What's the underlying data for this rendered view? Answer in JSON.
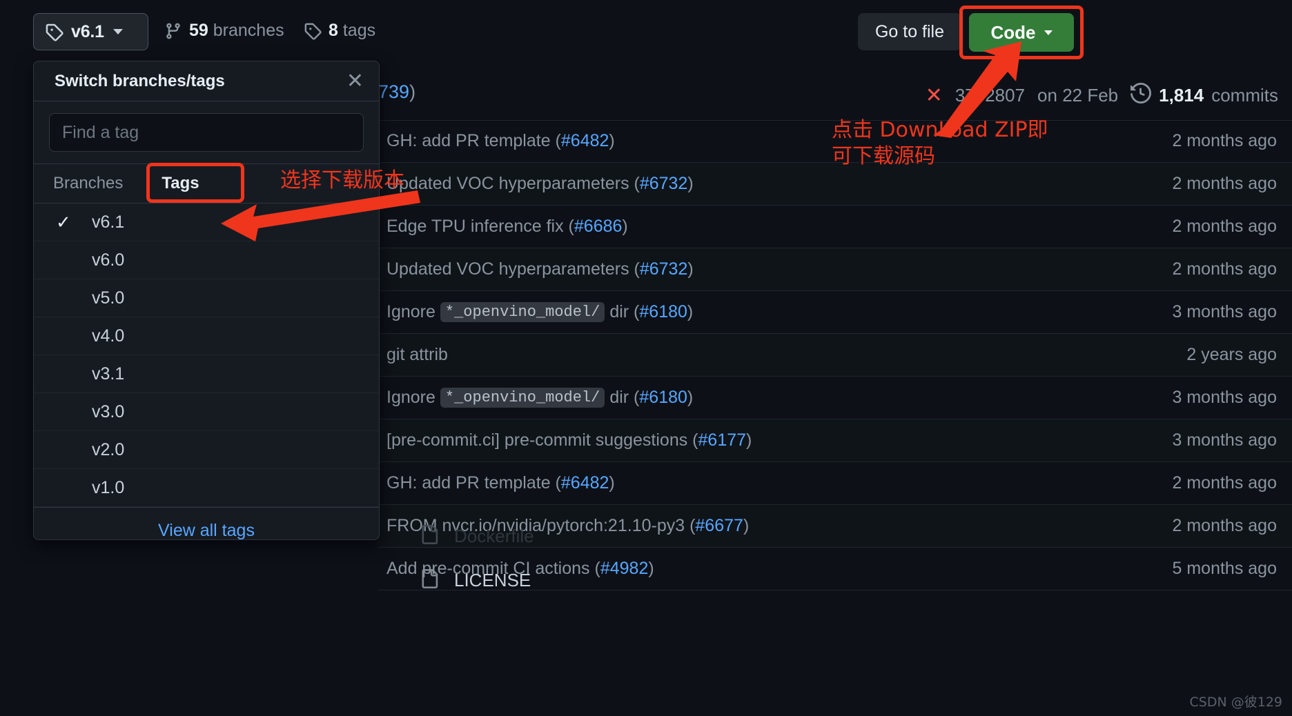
{
  "toolbar": {
    "branch_button": {
      "label": "v6.1",
      "icon": "tag-icon",
      "caret": "chevron-down-icon"
    },
    "branches": {
      "count": "59",
      "label": "branches",
      "icon": "branch-icon"
    },
    "tags": {
      "count": "8",
      "label": "tags",
      "icon": "tag-icon"
    },
    "go_to_file": "Go to file",
    "code_button": {
      "label": "Code",
      "caret": "chevron-down-icon",
      "color": "#347d39"
    }
  },
  "commit_bar": {
    "message_tail": "739",
    "paren_close": ")",
    "status_icon": "x-failure-icon",
    "sha": "3752807",
    "date": "on 22 Feb",
    "history_icon": "history-icon",
    "commits_count": "1,814",
    "commits_label": "commits"
  },
  "popover": {
    "title": "Switch branches/tags",
    "close_icon": "close-icon",
    "search_placeholder": "Find a tag",
    "search_value": "",
    "tabs": [
      {
        "label": "Branches",
        "active": false
      },
      {
        "label": "Tags",
        "active": true
      }
    ],
    "tags": [
      {
        "name": "v6.1",
        "selected": true
      },
      {
        "name": "v6.0",
        "selected": false
      },
      {
        "name": "v5.0",
        "selected": false
      },
      {
        "name": "v4.0",
        "selected": false
      },
      {
        "name": "v3.1",
        "selected": false
      },
      {
        "name": "v3.0",
        "selected": false
      },
      {
        "name": "v2.0",
        "selected": false
      },
      {
        "name": "v1.0",
        "selected": false
      }
    ],
    "check_glyph": "✓",
    "footer_link": "View all tags"
  },
  "file_rows": [
    {
      "message": "GH: add PR template (",
      "pr": "#6482",
      "close": ")",
      "time": "2 months ago",
      "alt": false
    },
    {
      "message": "Updated VOC hyperparameters (",
      "pr": "#6732",
      "close": ")",
      "time": "2 months ago",
      "alt": true
    },
    {
      "message": "Edge TPU inference fix (",
      "pr": "#6686",
      "close": ")",
      "time": "2 months ago",
      "alt": false
    },
    {
      "message": "Updated VOC hyperparameters (",
      "pr": "#6732",
      "close": ")",
      "time": "2 months ago",
      "alt": true
    },
    {
      "message": "Ignore ",
      "chip": "*_openvino_model/",
      "message2": " dir (",
      "pr": "#6180",
      "close": ")",
      "time": "3 months ago",
      "alt": false
    },
    {
      "message": "git attrib",
      "time": "2 years ago",
      "alt": true
    },
    {
      "message": "Ignore ",
      "chip": "*_openvino_model/",
      "message2": " dir (",
      "pr": "#6180",
      "close": ")",
      "time": "3 months ago",
      "alt": false
    },
    {
      "message": "[pre-commit.ci] pre-commit suggestions (",
      "pr": "#6177",
      "close": ")",
      "time": "3 months ago",
      "alt": true
    },
    {
      "message": "GH: add PR template (",
      "pr": "#6482",
      "close": ")",
      "time": "2 months ago",
      "alt": false
    },
    {
      "message": "FROM nvcr.io/nvidia/pytorch:21.10-py3 (",
      "pr": "#6677",
      "close": ")",
      "time": "2 months ago",
      "alt": true
    },
    {
      "message": "Add pre-commit CI actions (",
      "pr": "#4982",
      "close": ")",
      "time": "5 months ago",
      "alt": false
    }
  ],
  "hidden_files": [
    {
      "name": "Dockerfile",
      "icon": "file-icon"
    },
    {
      "name": "LICENSE",
      "icon": "file-icon"
    }
  ],
  "annotations": {
    "select_version": "选择下载版本",
    "download_zip_line1": "点击 DownLoad ZIP即",
    "download_zip_line2": "可下载源码",
    "box_color": "#f0351d"
  },
  "watermark": "CSDN @彼129"
}
